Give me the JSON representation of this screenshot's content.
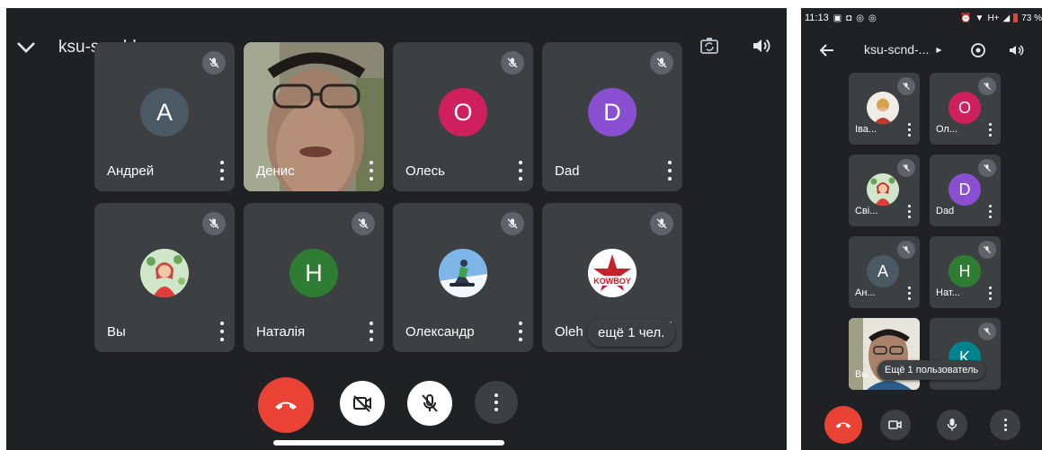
{
  "tablet": {
    "meeting_title": "ksu-scnd-hyg",
    "header_icons": [
      "chevron-down-icon",
      "meeting-title-caret-icon",
      "camera-flip-icon",
      "speaker-icon"
    ],
    "participants": [
      {
        "name": "Андрей",
        "initial": "A",
        "avatar_color": "#4a5963",
        "muted": true
      },
      {
        "name": "Денис",
        "initial": "",
        "avatar_color": "",
        "muted": false,
        "video": true
      },
      {
        "name": "Олесь",
        "initial": "O",
        "avatar_color": "#d01f5d",
        "muted": true
      },
      {
        "name": "Dad",
        "initial": "D",
        "avatar_color": "#8a4fd0",
        "muted": true
      },
      {
        "name": "Вы",
        "initial": "",
        "avatar_color": "#c9e8d0",
        "muted": true,
        "photo": "person-portrait"
      },
      {
        "name": "Наталія",
        "initial": "H",
        "avatar_color": "#2f7d32",
        "muted": true
      },
      {
        "name": "Олександр",
        "initial": "",
        "avatar_color": "#6aa6e0",
        "muted": true,
        "photo": "snowboarder"
      },
      {
        "name": "Oleh",
        "initial": "",
        "avatar_color": "#ffffff",
        "muted": true,
        "photo": "kowboy-logo"
      }
    ],
    "more_participants": "ещё 1 чел.",
    "controls": [
      "end-call-icon",
      "camera-off-icon",
      "mic-off-icon",
      "more-vert-icon"
    ],
    "logo_text": "KOWBOY"
  },
  "phone": {
    "status_time": "11:13",
    "status_battery": "73 %",
    "status_signal": "H+",
    "meeting_title": "ksu-scnd-...",
    "participants": [
      {
        "name": "Іва...",
        "initial": "",
        "avatar_color": "#e9d7c5",
        "photo": "portrait"
      },
      {
        "name": "Ол...",
        "initial": "O",
        "avatar_color": "#d01f5d"
      },
      {
        "name": "Сві...",
        "initial": "",
        "avatar_color": "#c9e8d0",
        "photo": "person-portrait"
      },
      {
        "name": "Dad",
        "initial": "D",
        "avatar_color": "#8a4fd0"
      },
      {
        "name": "Ан...",
        "initial": "A",
        "avatar_color": "#4a5963"
      },
      {
        "name": "Нат...",
        "initial": "H",
        "avatar_color": "#2f7d32"
      },
      {
        "name": "Вы",
        "initial": "",
        "avatar_color": "",
        "video": true
      },
      {
        "name": "",
        "initial": "K",
        "avatar_color": "#00838f"
      }
    ],
    "more_participants": "Ещё 1 пользователь",
    "controls": [
      "end-call-icon",
      "camera-icon",
      "mic-icon",
      "more-vert-icon"
    ]
  },
  "colors": {
    "end_call": "#ea4335",
    "background": "#202124",
    "tile": "#3c4043"
  }
}
